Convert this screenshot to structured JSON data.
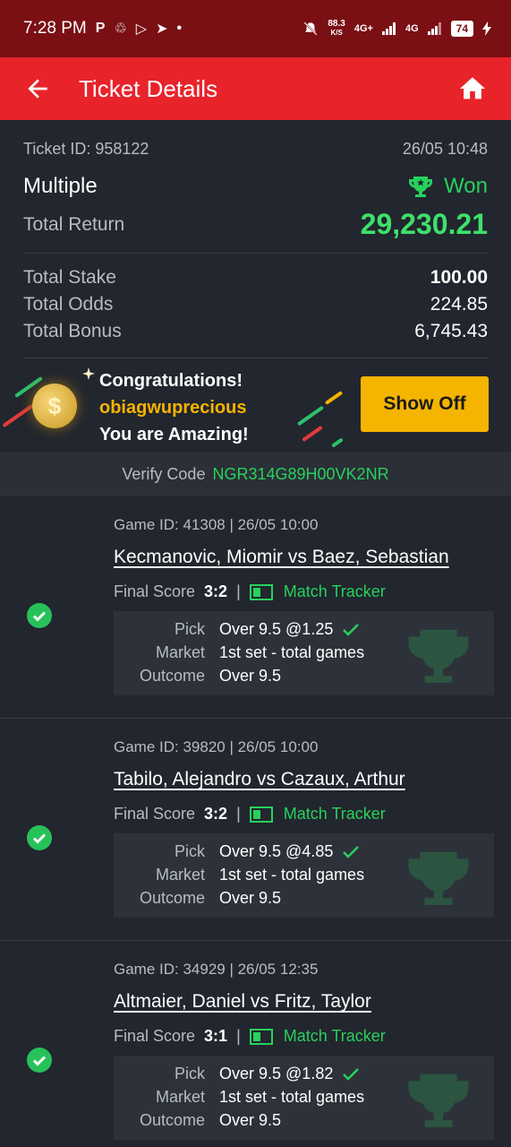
{
  "status_bar": {
    "time": "7:28 PM",
    "left_icons": [
      "P",
      "♲",
      "▷",
      "➤",
      "•"
    ],
    "speed_value": "88.3",
    "speed_unit": "K/S",
    "network1": "4G+",
    "network2": "4G",
    "battery": "74"
  },
  "app_bar": {
    "title": "Ticket Details"
  },
  "summary": {
    "ticket_id": "Ticket ID: 958122",
    "datetime": "26/05 10:48",
    "bet_type": "Multiple",
    "status": "Won",
    "total_return_label": "Total Return",
    "total_return_value": "29,230.21",
    "total_stake_label": "Total Stake",
    "total_stake_value": "100.00",
    "total_odds_label": "Total Odds",
    "total_odds_value": "224.85",
    "total_bonus_label": "Total Bonus",
    "total_bonus_value": "6,745.43"
  },
  "banner": {
    "line1": "Congratulations!",
    "username": "obiagwuprecious",
    "line3": "You are Amazing!",
    "button": "Show Off"
  },
  "verify": {
    "label": "Verify Code",
    "code": "NGR314G89H00VK2NR"
  },
  "games": [
    {
      "meta": "Game ID: 41308 | 26/05 10:00",
      "title": "Kecmanovic, Miomir vs Baez, Sebastian",
      "final_score_label": "Final Score",
      "score": "3:2",
      "separator": "|",
      "tracker": "Match Tracker",
      "pick_label": "Pick",
      "pick": "Over 9.5 @1.25",
      "market_label": "Market",
      "market": "1st set - total games",
      "outcome_label": "Outcome",
      "outcome": "Over 9.5"
    },
    {
      "meta": "Game ID: 39820 | 26/05 10:00",
      "title": "Tabilo, Alejandro vs Cazaux, Arthur",
      "final_score_label": "Final Score",
      "score": "3:2",
      "separator": "|",
      "tracker": "Match Tracker",
      "pick_label": "Pick",
      "pick": "Over 9.5 @4.85",
      "market_label": "Market",
      "market": "1st set - total games",
      "outcome_label": "Outcome",
      "outcome": "Over 9.5"
    },
    {
      "meta": "Game ID: 34929 | 26/05 12:35",
      "title": "Altmaier, Daniel vs Fritz, Taylor",
      "final_score_label": "Final Score",
      "score": "3:1",
      "separator": "|",
      "tracker": "Match Tracker",
      "pick_label": "Pick",
      "pick": "Over 9.5 @1.82",
      "market_label": "Market",
      "market": "1st set - total games",
      "outcome_label": "Outcome",
      "outcome": "Over 9.5"
    }
  ],
  "colors": {
    "status_bar": "#7a0f14",
    "app_bar": "#e8232a",
    "won_green": "#27d15c",
    "accent_yellow": "#f5b400",
    "background": "#1c1f25"
  }
}
